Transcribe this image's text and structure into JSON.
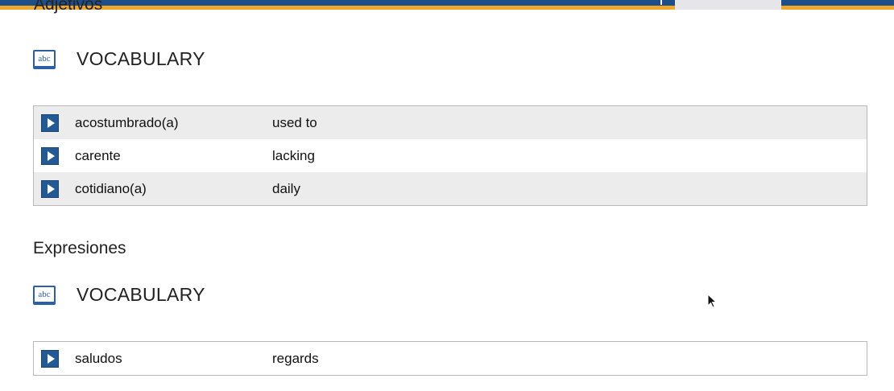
{
  "sections": [
    {
      "heading": "Adjetivos",
      "vocab_title": "VOCABULARY",
      "rows": [
        {
          "term": "acostumbrado(a)",
          "translation": "used to"
        },
        {
          "term": "carente",
          "translation": "lacking"
        },
        {
          "term": "cotidiano(a)",
          "translation": "daily"
        }
      ]
    },
    {
      "heading": "Expresiones",
      "vocab_title": "VOCABULARY",
      "rows": [
        {
          "term": "saludos",
          "translation": "regards"
        }
      ]
    }
  ],
  "icons": {
    "vocab_icon_text": "abc",
    "play": "play-icon"
  },
  "colors": {
    "top_bar": "#1d4e8a",
    "accent_orange": "#f0a62a",
    "play_button": "#235a96",
    "row_shade": "#ececec"
  }
}
